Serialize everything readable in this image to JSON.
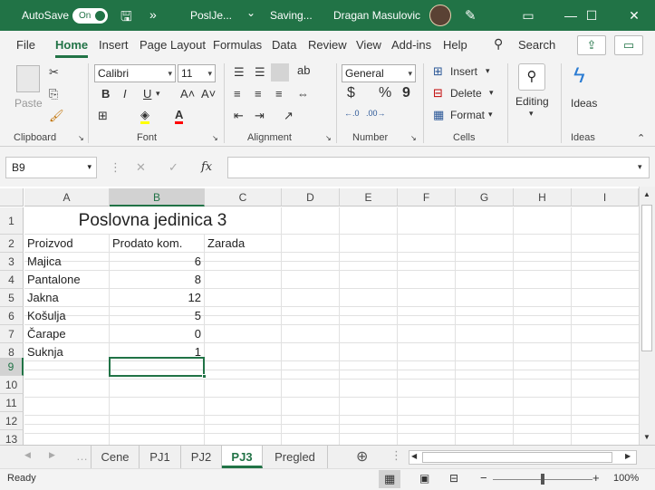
{
  "titlebar": {
    "autosave_label": "AutoSave",
    "autosave_state": "On",
    "filename": "PoslJe...",
    "status": "Saving...",
    "user": "Dragan Masulovic",
    "overflow": "»"
  },
  "menu": {
    "tabs": [
      "File",
      "Home",
      "Insert",
      "Page Layout",
      "Formulas",
      "Data",
      "Review",
      "View",
      "Add-ins",
      "Help"
    ],
    "active_tab": "Home",
    "search": "Search"
  },
  "ribbon": {
    "clipboard": {
      "label": "Clipboard",
      "paste": "Paste"
    },
    "font": {
      "label": "Font",
      "name": "Calibri",
      "size": "11",
      "bold": "B",
      "italic": "I",
      "underline": "U"
    },
    "alignment": {
      "label": "Alignment"
    },
    "number": {
      "label": "Number",
      "format": "General",
      "currency": "$",
      "percent": "%",
      "comma": "9"
    },
    "cells": {
      "label": "Cells",
      "insert": "Insert",
      "delete": "Delete",
      "format": "Format"
    },
    "editing": {
      "label": "Editing"
    },
    "ideas": {
      "label": "Ideas",
      "button": "Ideas"
    }
  },
  "formula_bar": {
    "name_box": "B9",
    "fx": "fx",
    "value": ""
  },
  "grid": {
    "columns": [
      "A",
      "B",
      "C",
      "D",
      "E",
      "F",
      "G",
      "H",
      "I"
    ],
    "rows": [
      "1",
      "2",
      "3",
      "4",
      "5",
      "6",
      "7",
      "8",
      "9",
      "10",
      "11",
      "12",
      "13"
    ],
    "title": "Poslovna jedinica 3",
    "headers": [
      "Proizvod",
      "Prodato kom.",
      "Zarada"
    ],
    "data": [
      {
        "product": "Majica",
        "qty": "6"
      },
      {
        "product": "Pantalone",
        "qty": "8"
      },
      {
        "product": "Jakna",
        "qty": "12"
      },
      {
        "product": "Košulja",
        "qty": "5"
      },
      {
        "product": "Čarape",
        "qty": "0"
      },
      {
        "product": "Suknja",
        "qty": "1"
      }
    ]
  },
  "sheets": {
    "tabs": [
      "Cene",
      "PJ1",
      "PJ2",
      "PJ3",
      "Pregled"
    ],
    "active": "PJ3",
    "add": "⊕"
  },
  "statusbar": {
    "status": "Ready",
    "zoom": "100%"
  },
  "colors": {
    "accent": "#217346",
    "ribbon_bg": "#f3f3f3"
  }
}
